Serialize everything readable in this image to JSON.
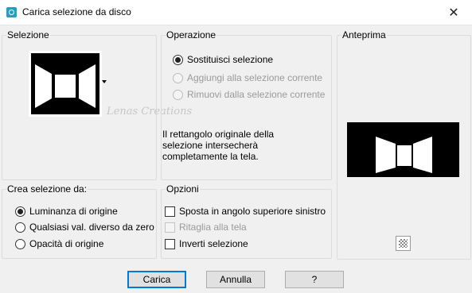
{
  "window": {
    "title": "Carica selezione da disco",
    "close_glyph": "✕"
  },
  "selezione": {
    "label": "Selezione"
  },
  "operazione": {
    "label": "Operazione",
    "options": [
      {
        "label": "Sostituisci selezione",
        "selected": true,
        "enabled": true
      },
      {
        "label": "Aggiungi alla selezione corrente",
        "selected": false,
        "enabled": false
      },
      {
        "label": "Rimuovi dalla selezione corrente",
        "selected": false,
        "enabled": false
      }
    ],
    "description": "Il rettangolo originale della selezione intersecherà completamente la tela."
  },
  "anteprima": {
    "label": "Anteprima"
  },
  "crea": {
    "label": "Crea selezione da:",
    "options": [
      {
        "label": "Luminanza di origine",
        "selected": true
      },
      {
        "label": "Qualsiasi val. diverso da zero",
        "selected": false
      },
      {
        "label": "Opacità di origine",
        "selected": false
      }
    ]
  },
  "opzioni": {
    "label": "Opzioni",
    "checks": [
      {
        "label": "Sposta in angolo superiore sinistro",
        "checked": false,
        "enabled": true
      },
      {
        "label": "Ritaglia alla tela",
        "checked": false,
        "enabled": false
      },
      {
        "label": "Inverti selezione",
        "checked": false,
        "enabled": true
      }
    ]
  },
  "watermark": "Lenas Creations",
  "buttons": {
    "ok": "Carica",
    "cancel": "Annulla",
    "help": "?"
  },
  "icons": {
    "app": "app-icon",
    "close": "close-icon",
    "dropdown": "dropdown-arrow-icon",
    "preview_toggle": "checkerboard-icon"
  },
  "colors": {
    "accent": "#0078d7",
    "dialog_bg": "#f0f0f0"
  }
}
